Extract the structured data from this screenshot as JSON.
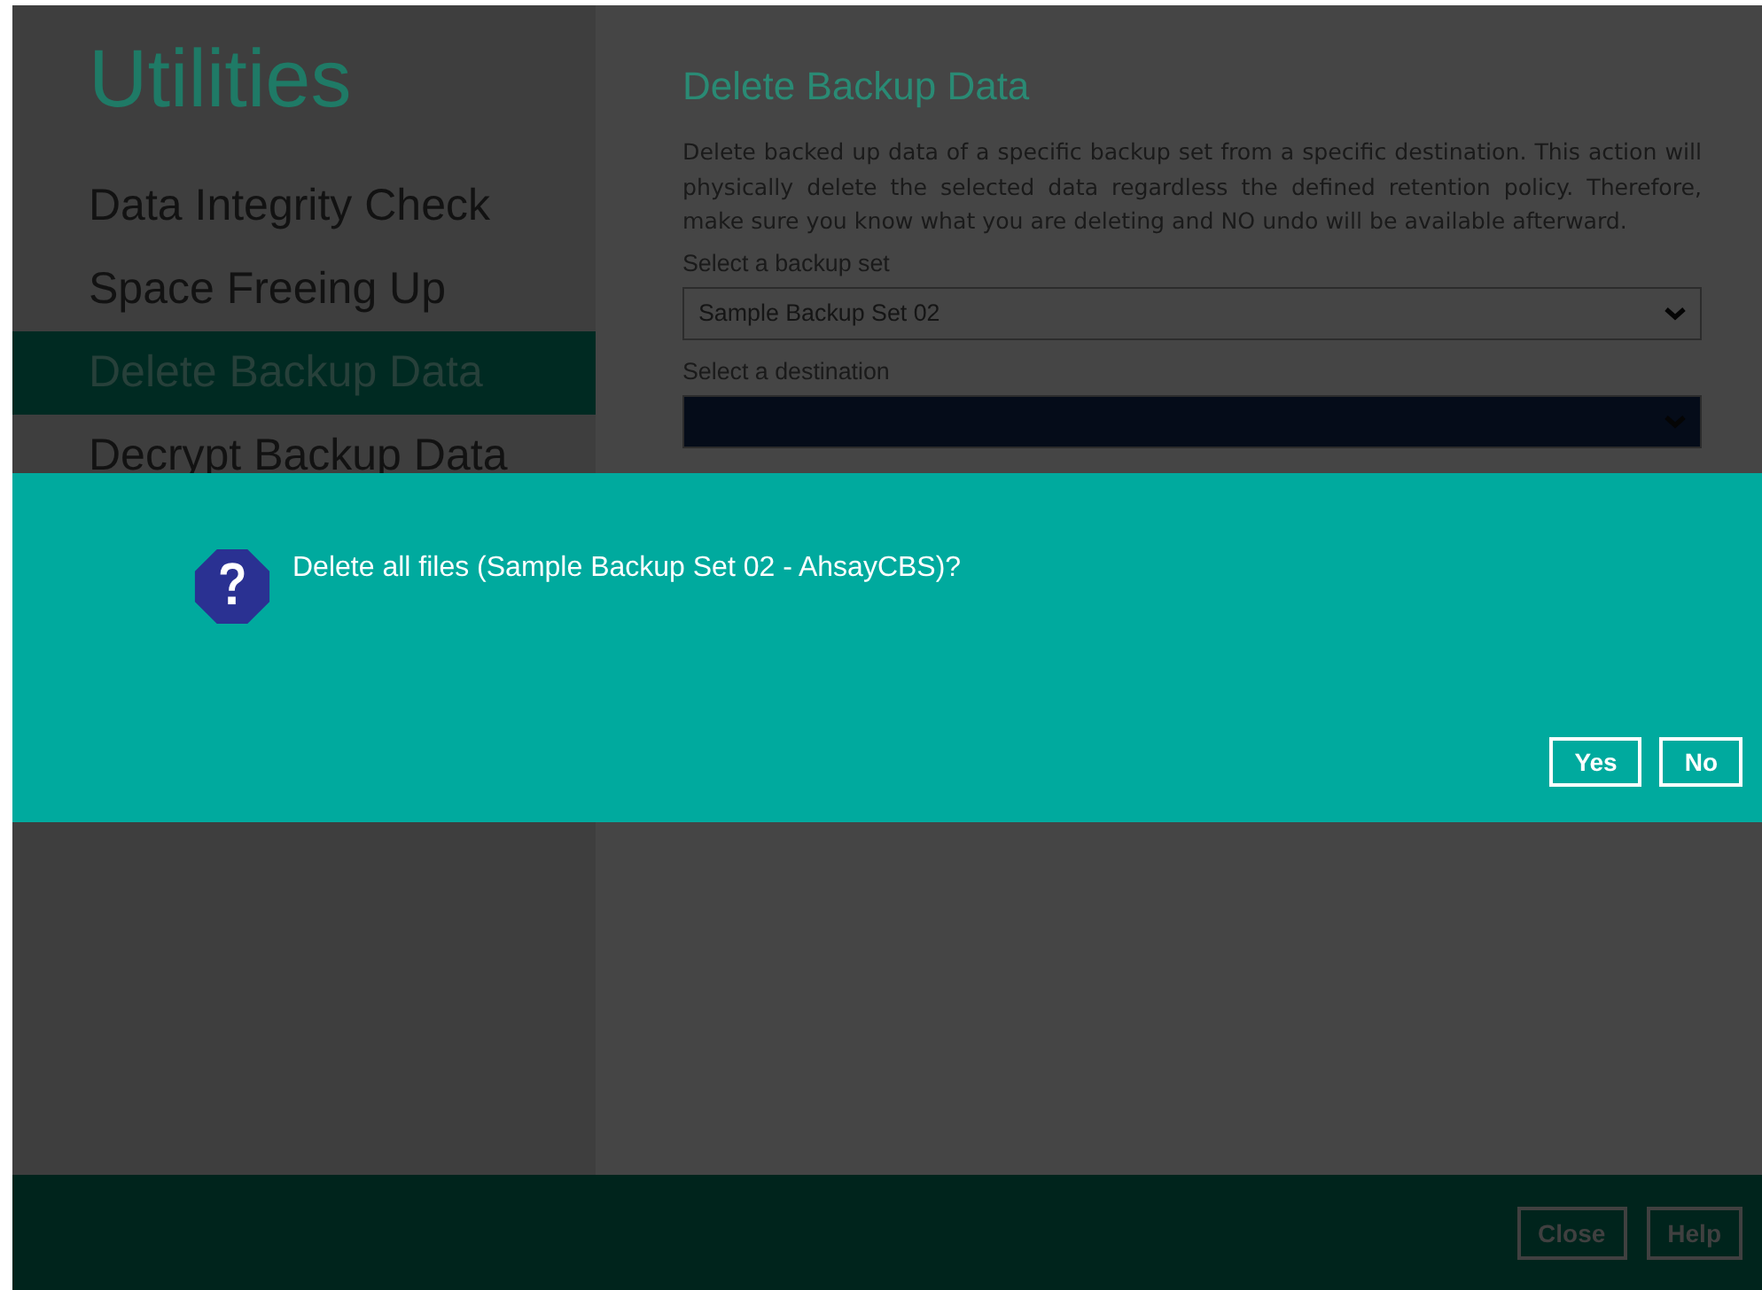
{
  "sidebar": {
    "title": "Utilities",
    "items": [
      {
        "label": "Data Integrity Check",
        "selected": false
      },
      {
        "label": "Space Freeing Up",
        "selected": false
      },
      {
        "label": "Delete Backup Data",
        "selected": true
      },
      {
        "label": "Decrypt Backup Data",
        "selected": false
      }
    ]
  },
  "main": {
    "title": "Delete Backup Data",
    "description": "Delete backed up data of a specific backup set from a specific destination. This action will physically delete the selected data regardless the defined retention policy. Therefore, make sure you know what you are deleting and NO undo will be available afterward.",
    "fields": [
      {
        "label": "Select a backup set",
        "value": "Sample Backup Set 02",
        "kind": "dropdown"
      },
      {
        "label": "Select a destination",
        "kind": "dropdown-dark"
      }
    ]
  },
  "dialog": {
    "message": "Delete all files (Sample Backup Set 02 - AhsayCBS)?",
    "buttons": [
      "Yes",
      "No"
    ]
  },
  "footer": {
    "buttons": [
      "Close",
      "Help"
    ]
  }
}
